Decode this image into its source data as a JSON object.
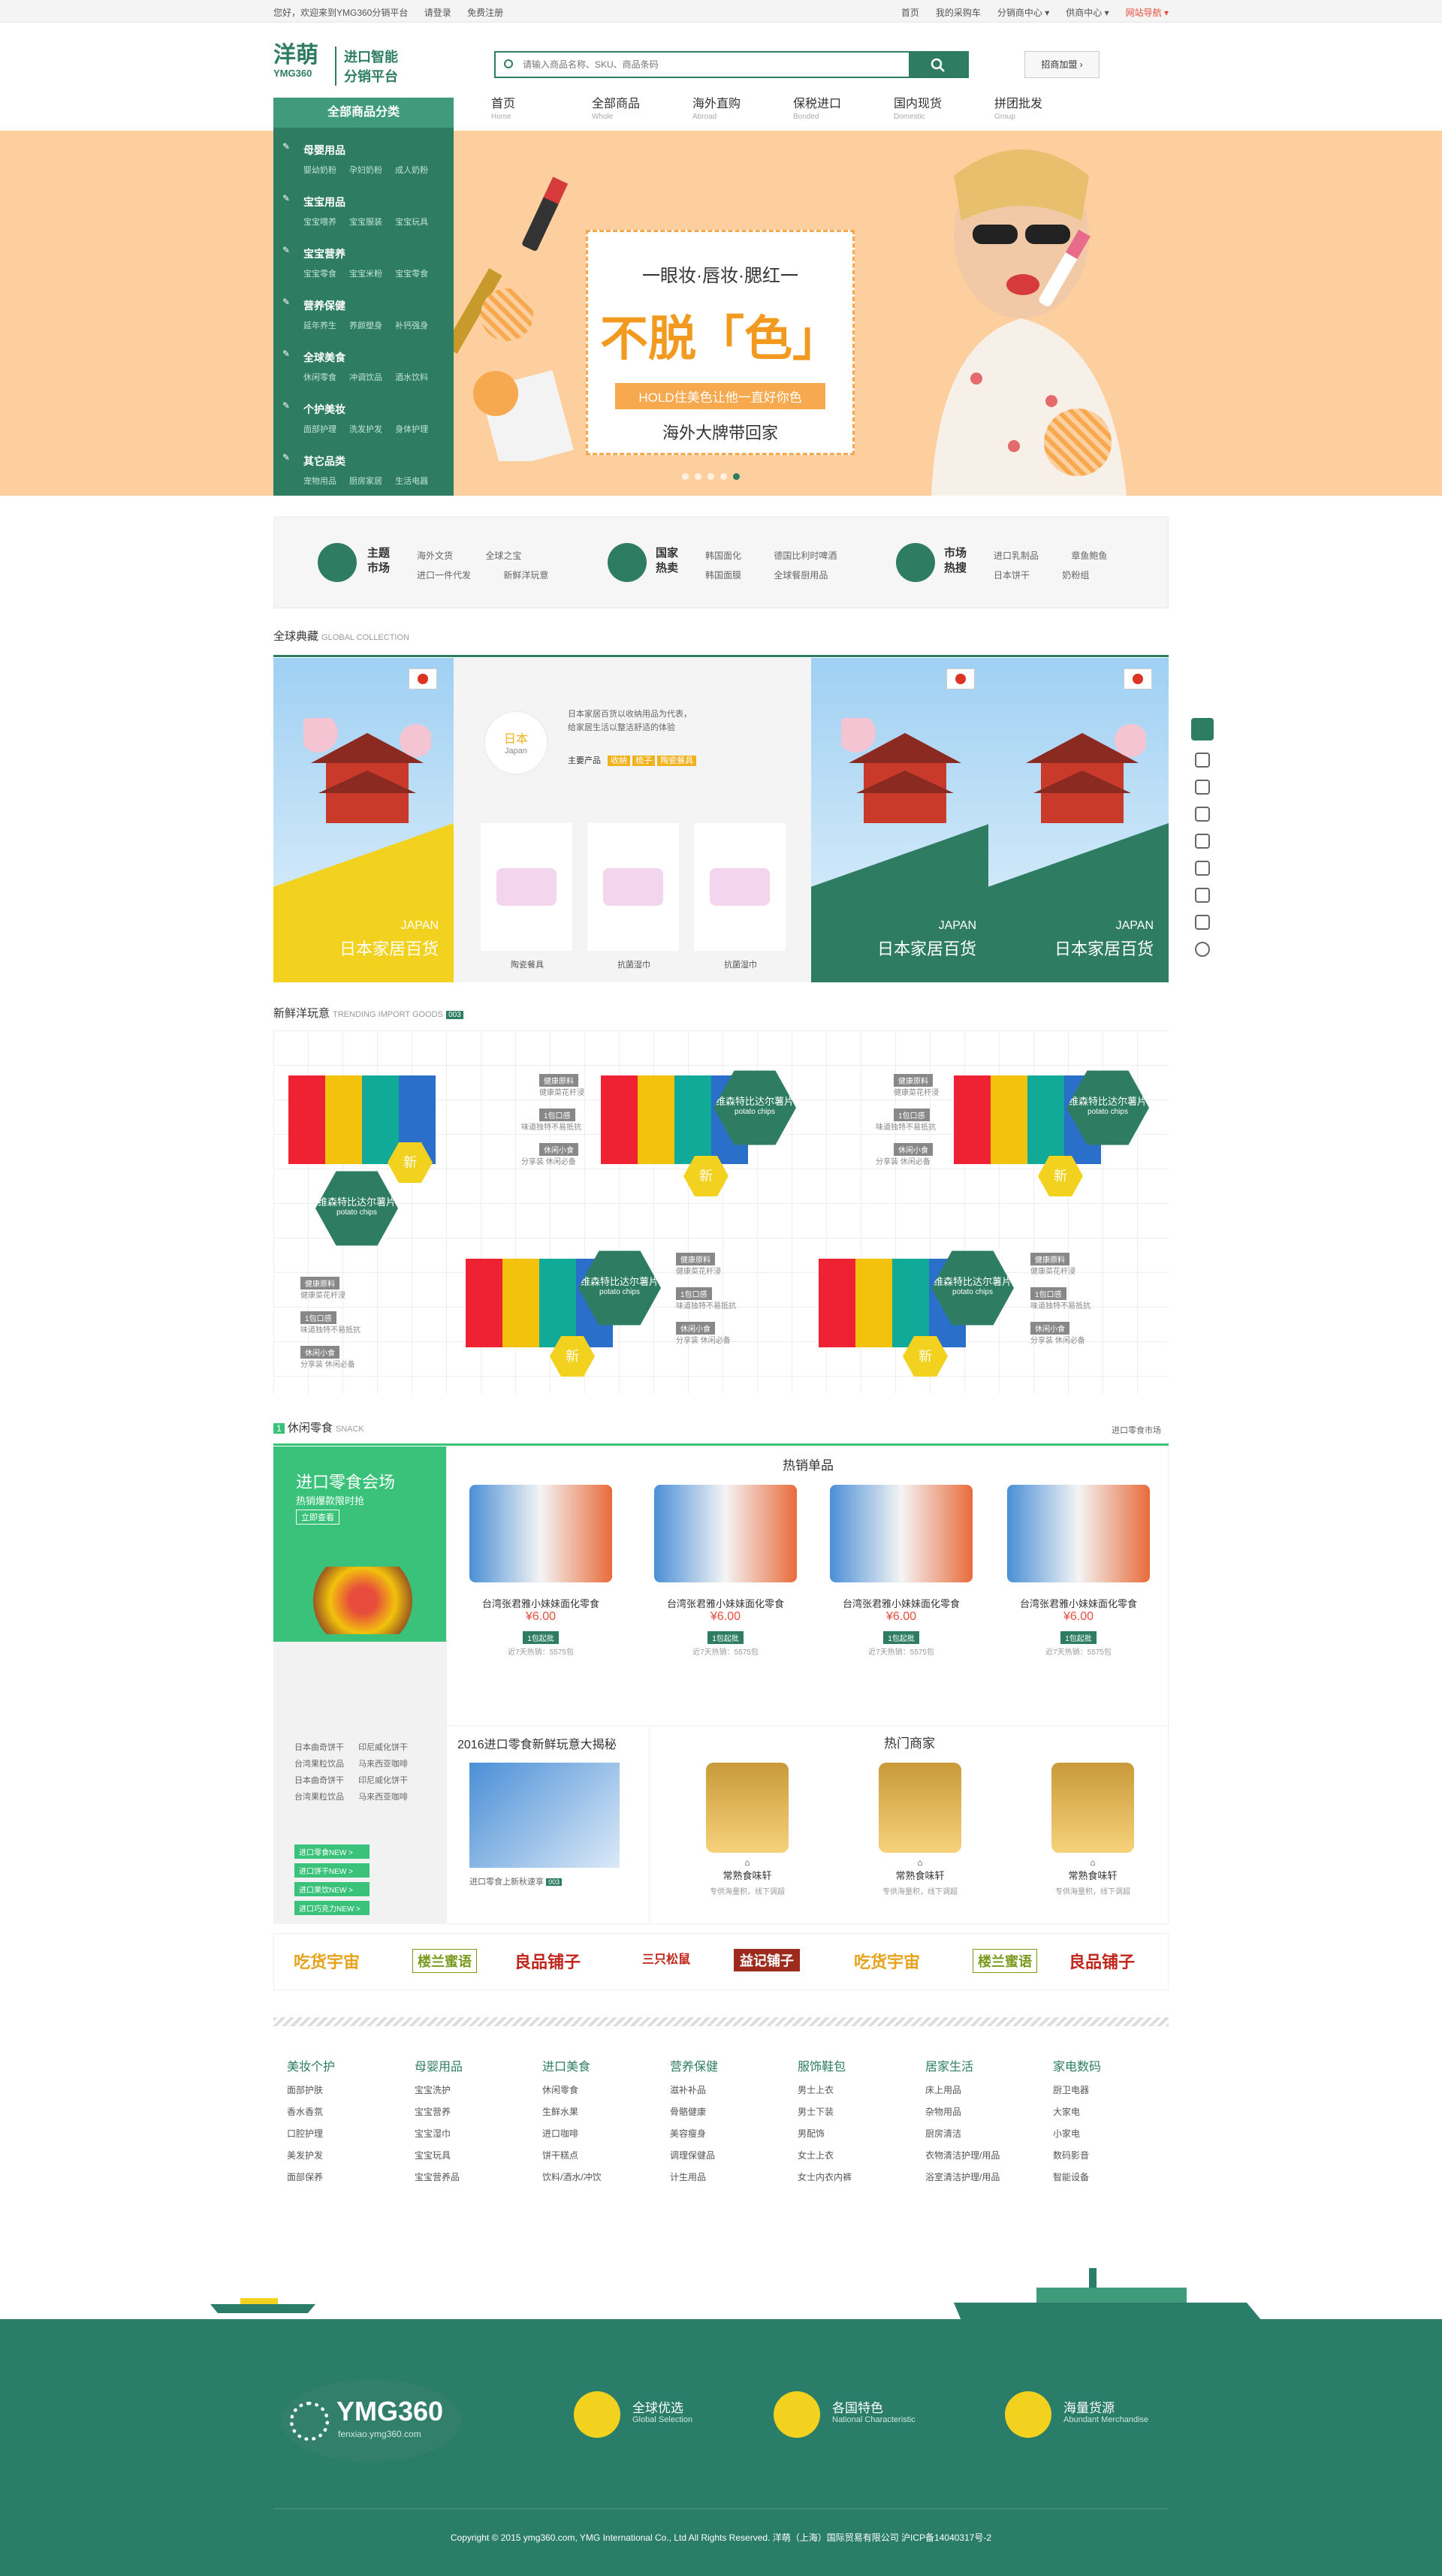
{
  "topbar": {
    "welcome": "您好，欢迎来到YMG360分销平台",
    "login": "请登录",
    "register": "免费注册",
    "links": [
      "首页",
      "我的采购车",
      "分销商中心 ▾",
      "供商中心 ▾",
      "网站导航 ▾"
    ]
  },
  "header": {
    "logo_cn": "洋萌",
    "logo_en": "YMG360",
    "logo_tag1": "进口智能",
    "logo_tag2": "分销平台",
    "search_placeholder": "请输入商品名称、SKU、商品条码",
    "join": "招商加盟"
  },
  "nav": [
    {
      "cn": "首页",
      "en": "Home"
    },
    {
      "cn": "全部商品",
      "en": "Whole"
    },
    {
      "cn": "海外直购",
      "en": "Abroad"
    },
    {
      "cn": "保税进口",
      "en": "Bonded"
    },
    {
      "cn": "国内现货",
      "en": "Domestic"
    },
    {
      "cn": "拼团批发",
      "en": "Group"
    }
  ],
  "sidebar": {
    "title": "全部商品分类",
    "categories": [
      {
        "title": "母婴用品",
        "sub": "婴幼奶粉 孕妇奶粉 成人奶粉"
      },
      {
        "title": "宝宝用品",
        "sub": "宝宝喂养 宝宝服装 宝宝玩具"
      },
      {
        "title": "宝宝营养",
        "sub": "宝宝零食 宝宝米粉 宝宝零食"
      },
      {
        "title": "营养保健",
        "sub": "延年养生 养颜塑身 补钙强身"
      },
      {
        "title": "全球美食",
        "sub": "休闲零食 冲调饮品 酒水饮料"
      },
      {
        "title": "个护美妆",
        "sub": "面部护理 洗发护发 身体护理"
      },
      {
        "title": "其它品类",
        "sub": "宠物用品 厨房家居 生活电器"
      }
    ]
  },
  "banner": {
    "line1": "一眼妆·唇妆·腮红一",
    "line2": "不脱「色」",
    "line3": "HOLD住美色让他一直好你色",
    "line4": "海外大牌带回家"
  },
  "themes": [
    {
      "title": "主题市场",
      "links": [
        "海外文货",
        "全球之宝",
        "进口一件代发",
        "新鲜洋玩意"
      ]
    },
    {
      "title": "国家热卖",
      "links": [
        "韩国面化",
        "德国比利时啤酒",
        "韩国面膜",
        "全球餐厨用品"
      ]
    },
    {
      "title": "市场热搜",
      "links": [
        "进口乳制品",
        "章鱼鲍鱼",
        "日本饼干",
        "奶粉组"
      ]
    }
  ],
  "global": {
    "title": "全球典藏",
    "title_en": "GLOBAL COLLECTION",
    "country_cn": "日本",
    "country_en": "Japan",
    "desc": "日本家居百货以收纳用品为代表，给家居生活以整洁舒适的体验",
    "main_label": "主要产品",
    "chips": [
      "收纳",
      "梳子",
      "陶瓷餐具"
    ],
    "products": [
      "陶瓷餐具",
      "抗菌湿巾",
      "抗菌湿巾"
    ],
    "card_en": "JAPAN",
    "card_cn": "日本家居百货"
  },
  "trending": {
    "title": "新鲜洋玩意",
    "title_en": "TRENDING IMPORT GOODS",
    "badge": "003",
    "product_name": "维森特比达尔薯片",
    "product_en": "potato chips",
    "new_label": "新",
    "tags": [
      "健康原料",
      "健康菜花杆浸",
      "1包口感",
      "味道独特不易抵抗",
      "休闲小食",
      "分享装 休闲必备"
    ]
  },
  "snack": {
    "index": "1",
    "title": "休闲零食",
    "title_en": "SNACK",
    "more": "进口零食市场",
    "promo_title": "进口零食会场",
    "promo_sub": "热销爆款限时抢",
    "promo_btn": "立即查看",
    "left_links": [
      "日本曲奇饼干",
      "印尼威化饼干",
      "台湾果粒饮品",
      "马来西亚咖啡"
    ],
    "left_links2": [
      "日本曲奇饼干",
      "印尼威化饼干",
      "台湾果粒饮品",
      "马来西亚咖啡"
    ],
    "left_tags": [
      "进口零食NEW >",
      "进口饼干NEW >",
      "进口果饮NEW >",
      "进口巧克力NEW >"
    ],
    "hot_title": "热销单品",
    "hot_name": "台湾张君雅小妹妹面化零食",
    "hot_price": "¥6.00",
    "hot_badge": "1包起批",
    "hot_sales": "近7天热销：5575包",
    "news_title": "2016进口零食新鲜玩意大揭秘",
    "news_caption": "进口零食上新秋速享",
    "news_badge": "003",
    "shops_title": "热门商家",
    "shop_name": "常熟食味轩",
    "shop_sub": "专供海量积，线下调超"
  },
  "brands": [
    "吃货宇宙",
    "楼兰蜜语",
    "良品铺子",
    "三只松鼠",
    "益记铺子",
    "吃货宇宙",
    "楼兰蜜语",
    "良品铺子"
  ],
  "footer_nav": [
    {
      "h": "美妆个护",
      "items": [
        "面部护肤",
        "香水香氛",
        "口腔护理",
        "美发护发",
        "面部保养"
      ]
    },
    {
      "h": "母婴用品",
      "items": [
        "宝宝洗护",
        "宝宝营养",
        "宝宝湿巾",
        "宝宝玩具",
        "宝宝营养品"
      ]
    },
    {
      "h": "进口美食",
      "items": [
        "休闲零食",
        "生鲜水果",
        "进口咖啡",
        "饼干糕点",
        "饮料/酒水/冲饮"
      ]
    },
    {
      "h": "营养保健",
      "items": [
        "滋补补品",
        "骨骼健康",
        "美容瘦身",
        "调理保健品",
        "计生用品"
      ]
    },
    {
      "h": "服饰鞋包",
      "items": [
        "男士上衣",
        "男士下装",
        "男配饰",
        "女士上衣",
        "女士内衣内裤"
      ]
    },
    {
      "h": "居家生活",
      "items": [
        "床上用品",
        "杂物用品",
        "厨房清洁",
        "衣物清洁护理/用品",
        "浴室清洁护理/用品"
      ]
    },
    {
      "h": "家电数码",
      "items": [
        "厨卫电器",
        "大家电",
        "小家电",
        "数码影音",
        "智能设备"
      ]
    }
  ],
  "footer": {
    "logo": "YMG360",
    "site": "fenxiao.ymg360.com",
    "features": [
      {
        "cn": "全球优选",
        "en": "Global Selection"
      },
      {
        "cn": "各国特色",
        "en": "National Characteristic"
      },
      {
        "cn": "海量货源",
        "en": "Abundant Merchandise"
      }
    ],
    "copyright": "Copyright © 2015 ymg360.com, YMG International Co., Ltd All Rights Reserved. 洋萌（上海）国际贸易有限公司 沪ICP备14040317号-2"
  },
  "colors": {
    "primary": "#2e7d63",
    "accent": "#f2d21e",
    "banner": "#fdcf9f"
  }
}
